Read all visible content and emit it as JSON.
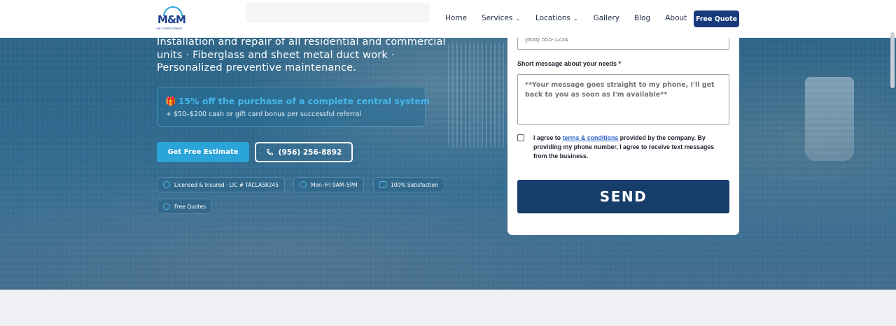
{
  "header": {
    "logo_text": "M&M",
    "logo_subtext": "AIR CONDITIONING",
    "nav": [
      {
        "label": "Home",
        "has_dropdown": false
      },
      {
        "label": "Services",
        "has_dropdown": true
      },
      {
        "label": "Locations",
        "has_dropdown": true
      },
      {
        "label": "Gallery",
        "has_dropdown": false
      },
      {
        "label": "Blog",
        "has_dropdown": false
      },
      {
        "label": "About",
        "has_dropdown": false
      }
    ],
    "cta_label": "Free Quote"
  },
  "hero": {
    "intro": "Installation and repair of all residential and commercial units · Fiberglass and sheet metal duct work · Personalized preventive maintenance.",
    "promo": {
      "icon": "gift-icon",
      "title": "15% off the purchase of a complete central system",
      "subtitle": "+ $50–$200 cash or gift card bonus per successful referral"
    },
    "primary_button": "Get Free Estimate",
    "phone_button": "(956) 256-8892",
    "badges": [
      {
        "icon": "shield-icon",
        "label": "Licensed & Insured · LIC # TACLA58245"
      },
      {
        "icon": "clock-icon",
        "label": "Mon–Fri 9AM–5PM"
      },
      {
        "icon": "thumbs-up-icon",
        "label": "100% Satisfaction"
      },
      {
        "icon": "check-circle-icon",
        "label": "Free Quotes"
      }
    ]
  },
  "form": {
    "phone_placeholder": "(808) 555-1234",
    "message_label": "Short message about your needs *",
    "message_placeholder": "**Your message goes straight to my phone, I'll get back to you as soon as I'm available**",
    "consent_prefix": "I agree to ",
    "consent_link": "terms & conditions",
    "consent_suffix": " provided by the company. By providing my phone number, I agree to receive text messages from the business.",
    "consent_checked": false,
    "submit_label": "SEND"
  },
  "colors": {
    "brand_navy": "#163a7a",
    "accent_blue": "#2ba4d9",
    "send_button": "#173e6a"
  }
}
